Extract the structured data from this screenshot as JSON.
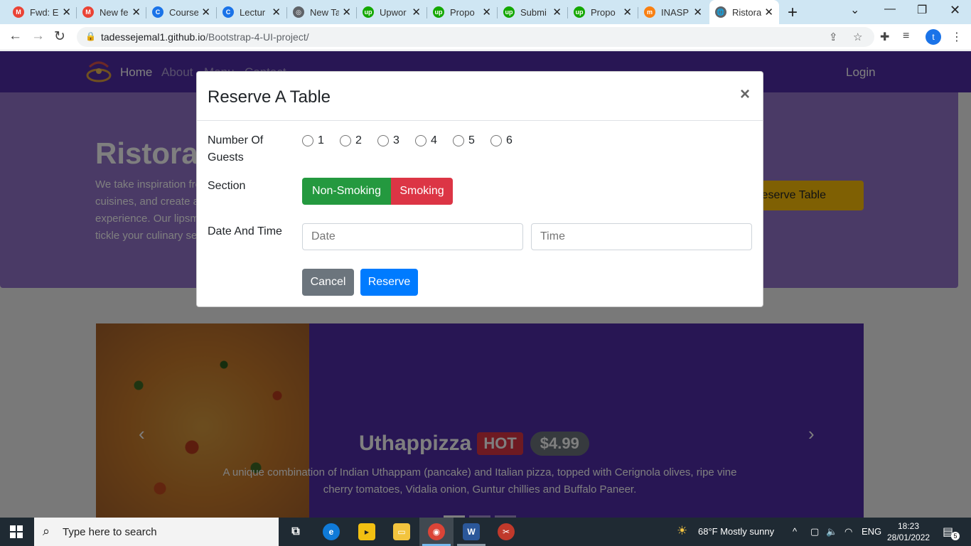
{
  "browser": {
    "tabs": [
      {
        "title": "Fwd: E",
        "favicon": "gmail-icon",
        "color": "#ea4335",
        "glyph": "M"
      },
      {
        "title": "New fe",
        "favicon": "gmail-icon",
        "color": "#ea4335",
        "glyph": "M"
      },
      {
        "title": "Course",
        "favicon": "coursera-icon",
        "color": "#1a73e8",
        "glyph": "C"
      },
      {
        "title": "Lectur",
        "favicon": "coursera-icon",
        "color": "#1a73e8",
        "glyph": "C"
      },
      {
        "title": "New Ta",
        "favicon": "chrome-icon",
        "color": "#5f6368",
        "glyph": "◎"
      },
      {
        "title": "Upwor",
        "favicon": "upwork-icon",
        "color": "#14a800",
        "glyph": "up"
      },
      {
        "title": "Propo",
        "favicon": "upwork-icon",
        "color": "#14a800",
        "glyph": "up"
      },
      {
        "title": "Submi",
        "favicon": "upwork-icon",
        "color": "#14a800",
        "glyph": "up"
      },
      {
        "title": "Propo",
        "favicon": "upwork-icon",
        "color": "#14a800",
        "glyph": "up"
      },
      {
        "title": "INASP",
        "favicon": "moodle-icon",
        "color": "#f98012",
        "glyph": "m"
      },
      {
        "title": "Ristora",
        "favicon": "globe-icon",
        "color": "#5f6368",
        "glyph": "🌐",
        "active": true
      }
    ],
    "url_host": "tadessejemal1.github.io",
    "url_path": "/Bootstrap-4-UI-project/",
    "profile_initial": "t"
  },
  "site": {
    "nav": {
      "home": "Home",
      "about": "About",
      "menu": "Menu",
      "contact": "Contact",
      "login": "Login"
    },
    "jumbotron": {
      "title": "Ristorante con Fusion",
      "text": "We take inspiration from the World's best cuisines, and create a unique fusion experience. Our lipsmacking creations will tickle your culinary senses!",
      "cta": "Reserve Table"
    },
    "carousel": {
      "dish": "Uthappizza",
      "badge": "HOT",
      "price": "$4.99",
      "description": "A unique combination of Indian Uthappam (pancake) and Italian pizza, topped with Cerignola olives, ripe vine cherry tomatoes, Vidalia onion, Guntur chillies and Buffalo Paneer."
    }
  },
  "modal": {
    "title": "Reserve A Table",
    "close": "×",
    "guests_label": "Number Of Guests",
    "guest_options": [
      "1",
      "2",
      "3",
      "4",
      "5",
      "6"
    ],
    "section_label": "Section",
    "section_options": {
      "non_smoking": "Non-Smoking",
      "smoking": "Smoking"
    },
    "section_selected": "Non-Smoking",
    "datetime_label": "Date And Time",
    "date_placeholder": "Date",
    "time_placeholder": "Time",
    "cancel": "Cancel",
    "reserve": "Reserve"
  },
  "taskbar": {
    "search_placeholder": "Type here to search",
    "weather": "68°F  Mostly sunny",
    "language": "ENG",
    "time": "18:23",
    "date": "28/01/2022",
    "notifications": "5"
  }
}
